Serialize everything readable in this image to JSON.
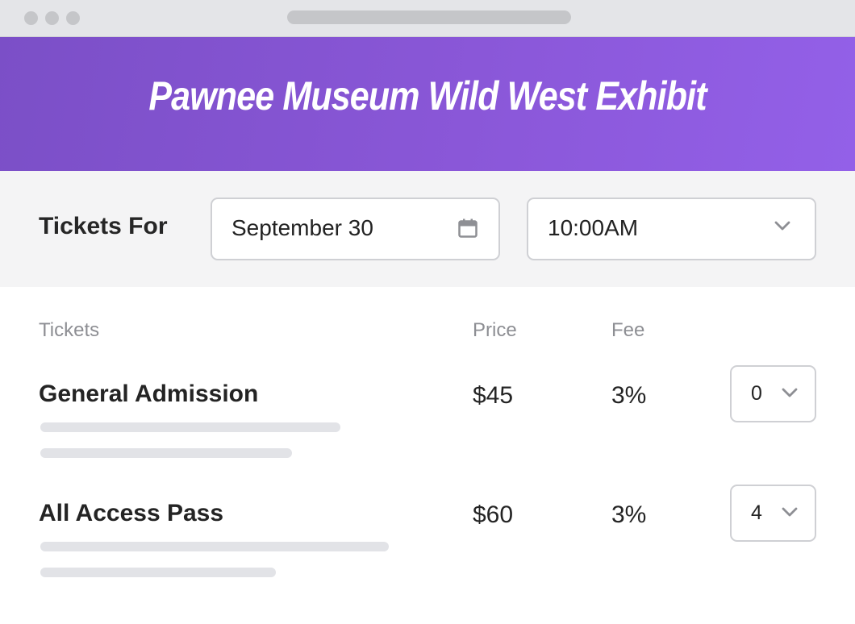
{
  "header": {
    "title": "Pawnee Museum Wild West Exhibit"
  },
  "filter": {
    "label": "Tickets For",
    "date_value": "September 30",
    "date_icon": "calendar-icon",
    "time_value": "10:00AM",
    "time_icon": "chevron-down-icon"
  },
  "table": {
    "columns": [
      "Tickets",
      "Price",
      "Fee"
    ],
    "rows": [
      {
        "name": "General Admission",
        "price": "$45",
        "fee": "3%",
        "quantity": "0"
      },
      {
        "name": "All Access Pass",
        "price": "$60",
        "fee": "3%",
        "quantity": "4"
      }
    ]
  },
  "colors": {
    "banner_start": "#7b4fc7",
    "banner_end": "#9360e8",
    "filter_bg": "#f4f4f5",
    "field_border": "#cfd0d4",
    "skeleton": "#e2e3e7"
  }
}
